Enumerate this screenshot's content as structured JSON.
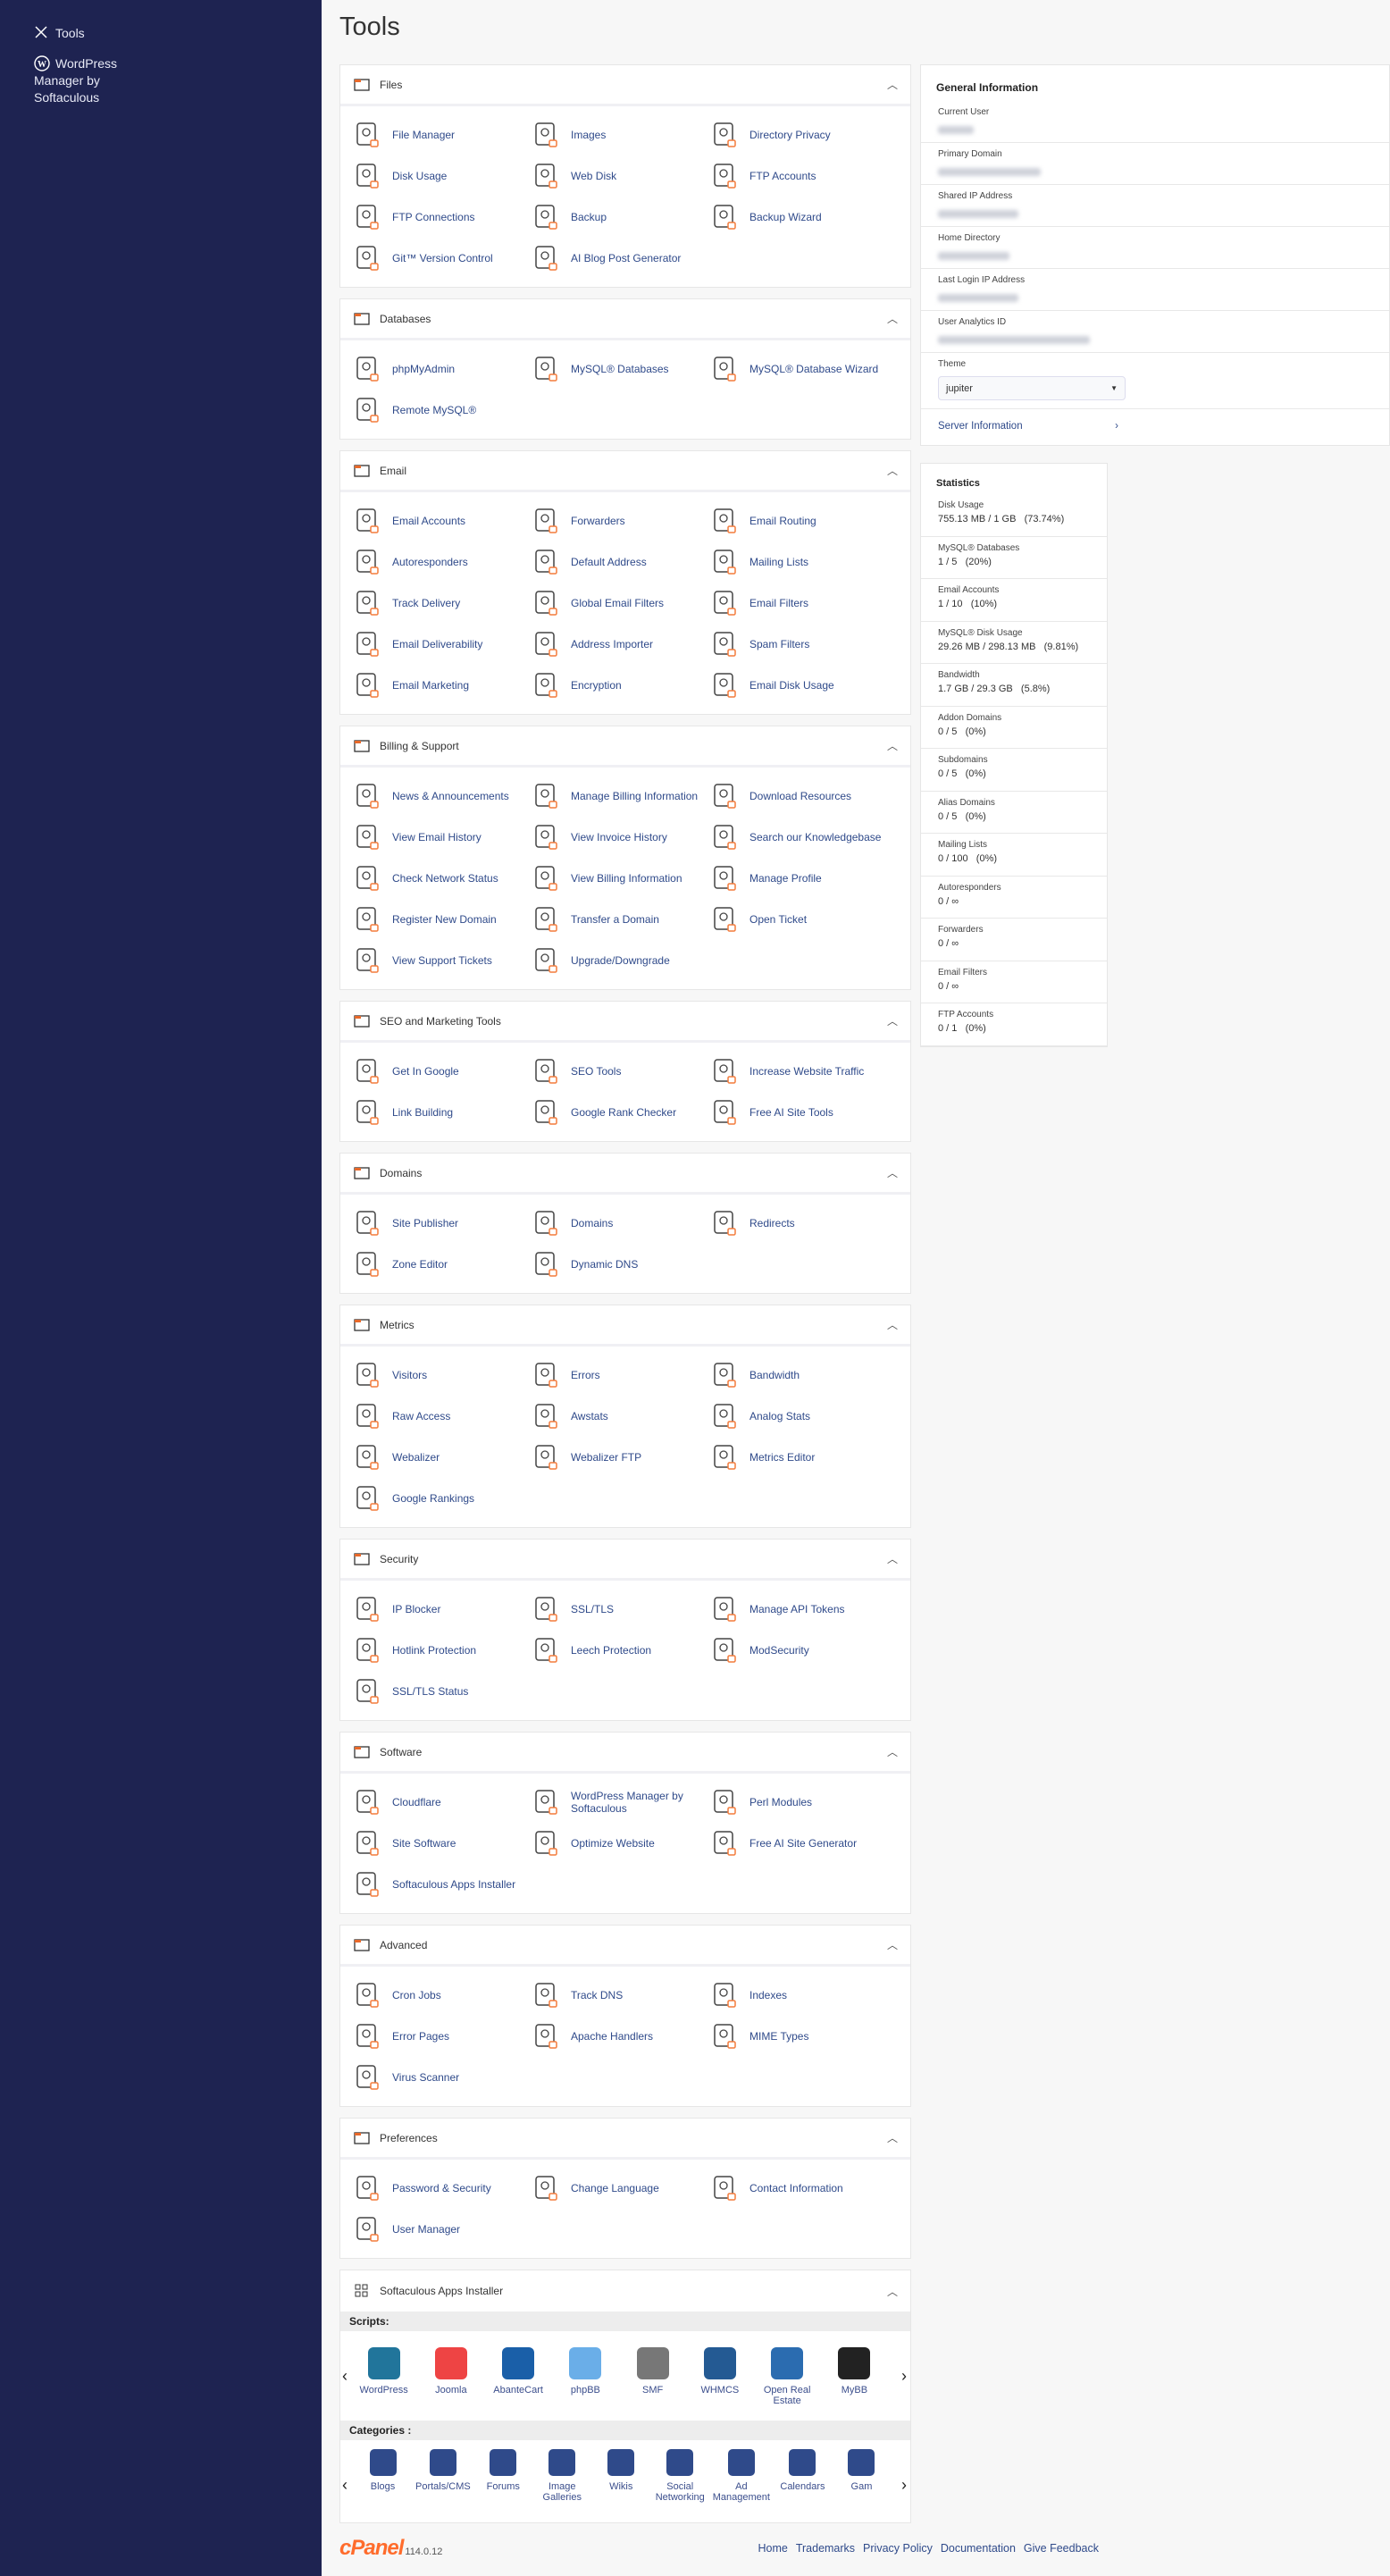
{
  "sidebar": {
    "items": [
      {
        "label": "Tools",
        "icon": "tools-icon"
      },
      {
        "label": "WordPress Manager by Softaculous",
        "icon": "wordpress-icon"
      }
    ]
  },
  "page_title": "Tools",
  "colors": {
    "sidebar": "#1e2351",
    "link": "#2f4a8a",
    "accent": "#ff6c2c"
  },
  "sections": [
    {
      "title": "Files",
      "icon": "folder-icon",
      "items": [
        "File Manager",
        "Images",
        "Directory Privacy",
        "Disk Usage",
        "Web Disk",
        "FTP Accounts",
        "FTP Connections",
        "Backup",
        "Backup Wizard",
        "Git™ Version Control",
        "AI Blog Post Generator"
      ]
    },
    {
      "title": "Databases",
      "icon": "database-icon",
      "items": [
        "phpMyAdmin",
        "MySQL® Databases",
        "MySQL® Database Wizard",
        "Remote MySQL®"
      ]
    },
    {
      "title": "Email",
      "icon": "envelope-icon",
      "items": [
        "Email Accounts",
        "Forwarders",
        "Email Routing",
        "Autoresponders",
        "Default Address",
        "Mailing Lists",
        "Track Delivery",
        "Global Email Filters",
        "Email Filters",
        "Email Deliverability",
        "Address Importer",
        "Spam Filters",
        "Email Marketing",
        "Encryption",
        "Email Disk Usage"
      ]
    },
    {
      "title": "Billing & Support",
      "icon": "grid-icon",
      "items": [
        "News & Announcements",
        "Manage Billing Information",
        "Download Resources",
        "View Email History",
        "View Invoice History",
        "Search our Knowledgebase",
        "Check Network Status",
        "View Billing Information",
        "Manage Profile",
        "Register New Domain",
        "Transfer a Domain",
        "Open Ticket",
        "View Support Tickets",
        "Upgrade/Downgrade"
      ]
    },
    {
      "title": "SEO and Marketing Tools",
      "icon": "grid-icon",
      "items": [
        "Get In Google",
        "SEO Tools",
        "Increase Website Traffic",
        "Link Building",
        "Google Rank Checker",
        "Free AI Site Tools"
      ]
    },
    {
      "title": "Domains",
      "icon": "globe-icon",
      "items": [
        "Site Publisher",
        "Domains",
        "Redirects",
        "Zone Editor",
        "Dynamic DNS"
      ]
    },
    {
      "title": "Metrics",
      "icon": "bar-chart-icon",
      "items": [
        "Visitors",
        "Errors",
        "Bandwidth",
        "Raw Access",
        "Awstats",
        "Analog Stats",
        "Webalizer",
        "Webalizer FTP",
        "Metrics Editor",
        "Google Rankings"
      ]
    },
    {
      "title": "Security",
      "icon": "shield-icon",
      "items": [
        "IP Blocker",
        "SSL/TLS",
        "Manage API Tokens",
        "Hotlink Protection",
        "Leech Protection",
        "ModSecurity",
        "SSL/TLS Status"
      ]
    },
    {
      "title": "Software",
      "icon": "code-icon",
      "items": [
        "Cloudflare",
        "WordPress Manager by Softaculous",
        "Perl Modules",
        "Site Software",
        "Optimize Website",
        "Free AI Site Generator",
        "Softaculous Apps Installer"
      ]
    },
    {
      "title": "Advanced",
      "icon": "gear-icon",
      "items": [
        "Cron Jobs",
        "Track DNS",
        "Indexes",
        "Error Pages",
        "Apache Handlers",
        "MIME Types",
        "Virus Scanner"
      ]
    },
    {
      "title": "Preferences",
      "icon": "sliders-icon",
      "items": [
        "Password & Security",
        "Change Language",
        "Contact Information",
        "User Manager"
      ]
    }
  ],
  "softaculous": {
    "title": "Softaculous Apps Installer",
    "scripts_label": "Scripts:",
    "categories_label": "Categories :",
    "scripts": [
      "WordPress",
      "Joomla",
      "AbanteCart",
      "phpBB",
      "SMF",
      "WHMCS",
      "Open Real Estate",
      "MyBB"
    ],
    "categories": [
      "Blogs",
      "Portals/CMS",
      "Forums",
      "Image Galleries",
      "Wikis",
      "Social Networking",
      "Ad Management",
      "Calendars",
      "Gam"
    ]
  },
  "general_info": {
    "title": "General Information",
    "fields": [
      "Current User",
      "Primary Domain",
      "Shared IP Address",
      "Home Directory",
      "Last Login IP Address",
      "User Analytics ID"
    ],
    "theme_label": "Theme",
    "theme_value": "jupiter",
    "server_info": "Server Information"
  },
  "statistics": {
    "title": "Statistics",
    "rows": [
      {
        "label": "Disk Usage",
        "value": "755.13 MB / 1 GB   (73.74%)"
      },
      {
        "label": "MySQL® Databases",
        "value": "1 / 5   (20%)"
      },
      {
        "label": "Email Accounts",
        "value": "1 / 10   (10%)"
      },
      {
        "label": "MySQL® Disk Usage",
        "value": "29.26 MB / 298.13 MB   (9.81%)"
      },
      {
        "label": "Bandwidth",
        "value": "1.7 GB / 29.3 GB   (5.8%)"
      },
      {
        "label": "Addon Domains",
        "value": "0 / 5   (0%)"
      },
      {
        "label": "Subdomains",
        "value": "0 / 5   (0%)"
      },
      {
        "label": "Alias Domains",
        "value": "0 / 5   (0%)"
      },
      {
        "label": "Mailing Lists",
        "value": "0 / 100   (0%)"
      },
      {
        "label": "Autoresponders",
        "value": "0 / ∞"
      },
      {
        "label": "Forwarders",
        "value": "0 / ∞"
      },
      {
        "label": "Email Filters",
        "value": "0 / ∞"
      },
      {
        "label": "FTP Accounts",
        "value": "0 / 1   (0%)"
      }
    ]
  },
  "footer": {
    "logo": "cPanel",
    "version": "114.0.12",
    "links": [
      "Home",
      "Trademarks",
      "Privacy Policy",
      "Documentation",
      "Give Feedback"
    ]
  }
}
